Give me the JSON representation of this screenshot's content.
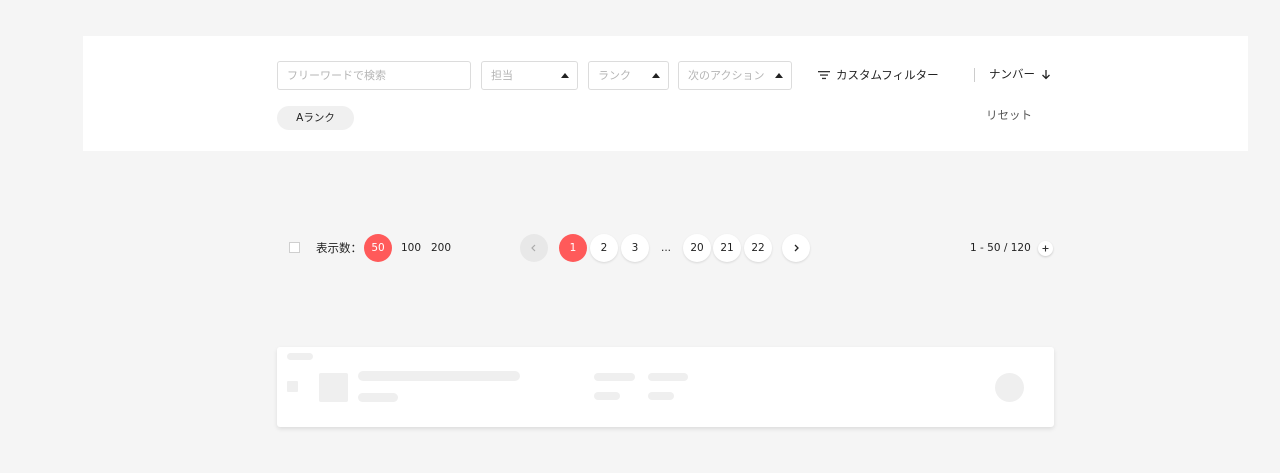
{
  "filters": {
    "search_placeholder": "フリーワードで検索",
    "assignee_placeholder": "担当",
    "rank_placeholder": "ランク",
    "next_action_placeholder": "次のアクション",
    "custom_filter_label": "カスタムフィルター",
    "sort_label": "ナンバー",
    "active_chip": "Aランク",
    "reset_label": "リセット"
  },
  "pagination": {
    "per_page_label": "表示数：",
    "per_page_options": [
      "50",
      "100",
      "200"
    ],
    "per_page_selected": "50",
    "pages": [
      "1",
      "2",
      "3",
      "20",
      "21",
      "22"
    ],
    "ellipsis": "...",
    "current_page": "1",
    "range_text": "1 - 50 / 120"
  },
  "colors": {
    "accent": "#ff5a5a",
    "background": "#f5f5f5"
  }
}
